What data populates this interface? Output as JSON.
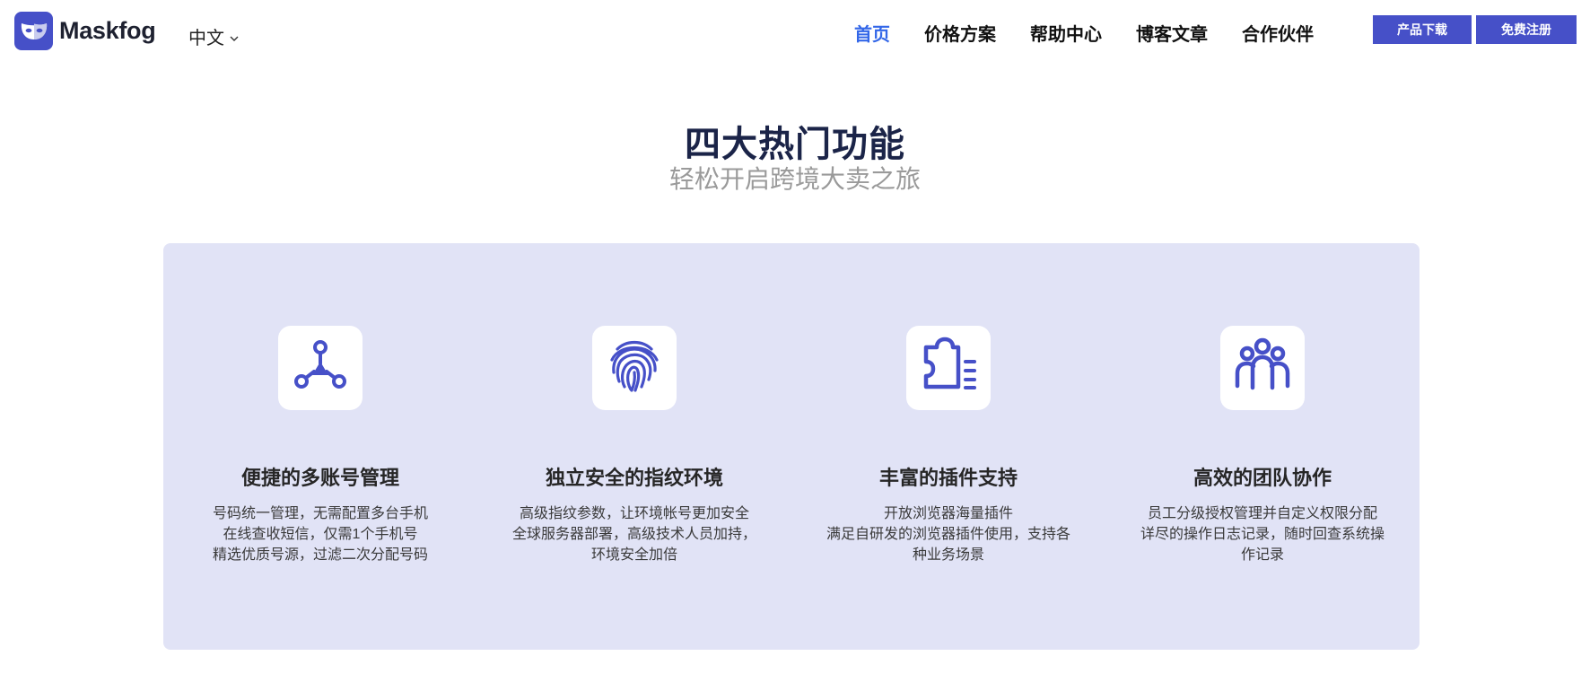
{
  "brand": {
    "name": "Maskfog",
    "color": "#4650c8"
  },
  "language": {
    "current": "中文"
  },
  "nav": {
    "items": [
      {
        "label": "首页",
        "active": true
      },
      {
        "label": "价格方案",
        "active": false
      },
      {
        "label": "帮助中心",
        "active": false
      },
      {
        "label": "博客文章",
        "active": false
      },
      {
        "label": "合作伙伴",
        "active": false
      }
    ],
    "active_color": "#3367e8"
  },
  "actions": {
    "download_label": "产品下载",
    "register_label": "免费注册"
  },
  "section": {
    "title": "四大热门功能",
    "subtitle": "轻松开启跨境大卖之旅"
  },
  "features": [
    {
      "icon": "network-nodes-icon",
      "title": "便捷的多账号管理",
      "lines": [
        "号码统一管理，无需配置多台手机",
        "在线查收短信，仅需1个手机号",
        "精选优质号源，过滤二次分配号码"
      ]
    },
    {
      "icon": "fingerprint-icon",
      "title": "独立安全的指纹环境",
      "lines": [
        "高级指纹参数，让环境帐号更加安全",
        "全球服务器部署，高级技术人员加持，",
        "环境安全加倍"
      ]
    },
    {
      "icon": "puzzle-plugin-icon",
      "title": "丰富的插件支持",
      "lines": [
        "开放浏览器海量插件",
        "满足自研发的浏览器插件使用，支持各",
        "种业务场景"
      ]
    },
    {
      "icon": "team-icon",
      "title": "高效的团队协作",
      "lines": [
        "员工分级授权管理并自定义权限分配",
        "详尽的操作日志记录，随时回查系统操",
        "作记录"
      ]
    }
  ],
  "panel_color": "#e1e3f6",
  "icon_color": "#4650c8"
}
